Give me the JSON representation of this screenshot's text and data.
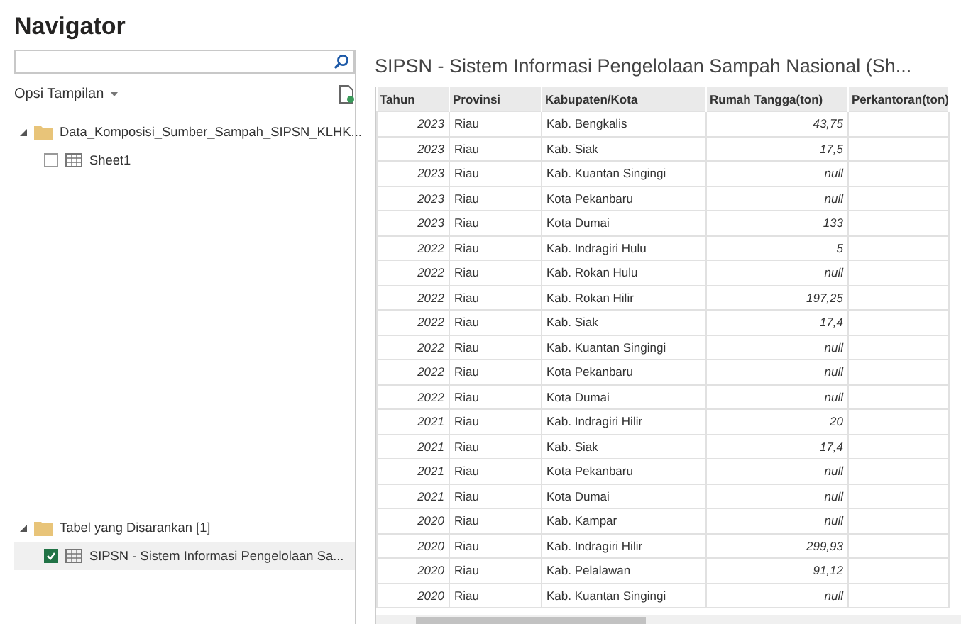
{
  "window": {
    "title": "Navigator"
  },
  "view_options": {
    "label": "Opsi Tampilan"
  },
  "tree": [
    {
      "label": "Data_Komposisi_Sumber_Sampah_SIPSN_KLHK...",
      "expanded": true,
      "children": [
        {
          "label": "Sheet1",
          "checked": false,
          "selected": false
        }
      ]
    }
  ],
  "suggested": [
    {
      "label": "Tabel yang Disarankan [1]",
      "expanded": true,
      "children": [
        {
          "label": "SIPSN - Sistem Informasi Pengelolaan Sa...",
          "checked": true,
          "selected": true
        }
      ]
    }
  ],
  "preview": {
    "title": "SIPSN - Sistem Informasi Pengelolaan Sampah Nasional (Sh...",
    "columns": [
      "Tahun",
      "Provinsi",
      "Kabupaten/Kota",
      "Rumah Tangga(ton)",
      "Perkantoran(ton)"
    ],
    "rows": [
      [
        "2023",
        "Riau",
        "Kab. Bengkalis",
        "43,75"
      ],
      [
        "2023",
        "Riau",
        "Kab. Siak",
        "17,5"
      ],
      [
        "2023",
        "Riau",
        "Kab. Kuantan Singingi",
        "null"
      ],
      [
        "2023",
        "Riau",
        "Kota Pekanbaru",
        "null"
      ],
      [
        "2023",
        "Riau",
        "Kota Dumai",
        "133"
      ],
      [
        "2022",
        "Riau",
        "Kab. Indragiri Hulu",
        "5"
      ],
      [
        "2022",
        "Riau",
        "Kab. Rokan Hulu",
        "null"
      ],
      [
        "2022",
        "Riau",
        "Kab. Rokan Hilir",
        "197,25"
      ],
      [
        "2022",
        "Riau",
        "Kab. Siak",
        "17,4"
      ],
      [
        "2022",
        "Riau",
        "Kab. Kuantan Singingi",
        "null"
      ],
      [
        "2022",
        "Riau",
        "Kota Pekanbaru",
        "null"
      ],
      [
        "2022",
        "Riau",
        "Kota Dumai",
        "null"
      ],
      [
        "2021",
        "Riau",
        "Kab. Indragiri Hilir",
        "20"
      ],
      [
        "2021",
        "Riau",
        "Kab. Siak",
        "17,4"
      ],
      [
        "2021",
        "Riau",
        "Kota Pekanbaru",
        "null"
      ],
      [
        "2021",
        "Riau",
        "Kota Dumai",
        "null"
      ],
      [
        "2020",
        "Riau",
        "Kab. Kampar",
        "null"
      ],
      [
        "2020",
        "Riau",
        "Kab. Indragiri Hilir",
        "299,93"
      ],
      [
        "2020",
        "Riau",
        "Kab. Pelalawan",
        "91,12"
      ],
      [
        "2020",
        "Riau",
        "Kab. Kuantan Singingi",
        "null"
      ]
    ]
  }
}
